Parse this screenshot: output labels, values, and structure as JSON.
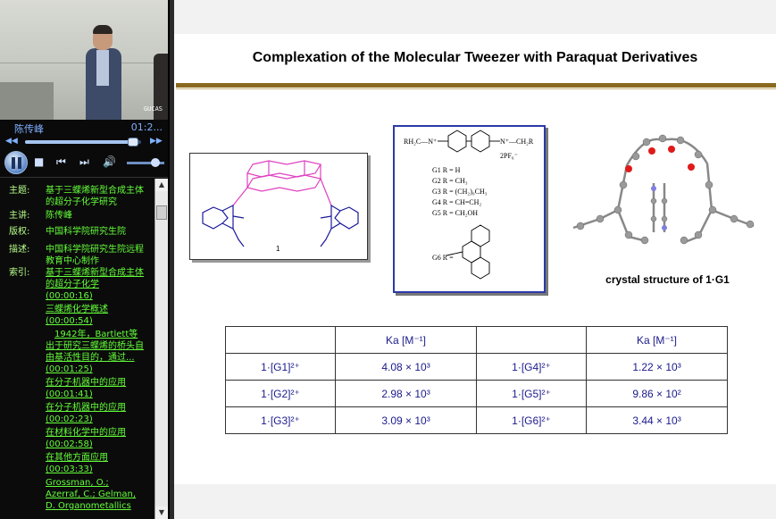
{
  "player": {
    "speaker_name": "陈传峰",
    "time": "01:2...",
    "video_logo": "GUCAS"
  },
  "info": {
    "rows": [
      {
        "label": "主题:",
        "value": "基于三蝶烯新型合成主体的超分子化学研究"
      },
      {
        "label": "主讲:",
        "value": "陈传峰"
      },
      {
        "label": "版权:",
        "value": "中国科学院研究生院"
      },
      {
        "label": "描述:",
        "value": "中国科学院研究生院远程教育中心制作"
      }
    ],
    "index_label": "索引:",
    "index_links": [
      "基于三蝶烯新型合成主体的超分子化学",
      "(00:00:16)",
      "三蝶烯化学概述",
      "(00:00:54)",
      "1942年，Bartlett等出于研究三蝶烯的桥头自由基活性目的，通过...(00:01:25)",
      "在分子机器中的应用",
      "(00:01:41)",
      "在分子机器中的应用",
      "(00:02:23)",
      "在材料化学中的应用",
      "(00:02:58)",
      "在其他方面应用",
      "(00:03:33)",
      "Grossman, O.; Azerraf, C.; Gelman, D. Organometallics"
    ]
  },
  "slide": {
    "title": "Complexation of the Molecular Tweezer with Paraquat Derivatives",
    "tweezer_label": "1",
    "guests": {
      "top_left": "RH₂C—N⁺",
      "top_right": "N⁺—CH₂R",
      "counterion": "2PF₆⁻",
      "g1": "G1 R = H",
      "g2": "G2 R = CH₃",
      "g3": "G3 R = (CH₂)₆CH₃",
      "g4": "G4 R = CH=CH₂",
      "g5": "G5 R = CH₂OH",
      "g6": "G6 R ="
    },
    "crystal_caption": "crystal structure of 1·G1",
    "table": {
      "header": [
        "",
        "Ka [M⁻¹]",
        "",
        "Ka [M⁻¹]"
      ],
      "rows": [
        [
          "1·[G1]²⁺",
          "4.08 × 10³",
          "1·[G4]²⁺",
          "1.22 × 10³"
        ],
        [
          "1·[G2]²⁺",
          "2.98 × 10³",
          "1·[G5]²⁺",
          "9.86 × 10²"
        ],
        [
          "1·[G3]²⁺",
          "3.09 × 10³",
          "1·[G6]²⁺",
          "3.44 × 10³"
        ]
      ]
    }
  },
  "colors": {
    "accent_green": "#64ff3a",
    "label_green": "#b8ff8a",
    "table_text_blue": "#1a1a8c",
    "title_rule": "#8a6a1e",
    "guest_box_border": "#2b3aa8"
  },
  "playback": {
    "seek_fraction": 0.93,
    "volume_fraction": 0.75
  }
}
